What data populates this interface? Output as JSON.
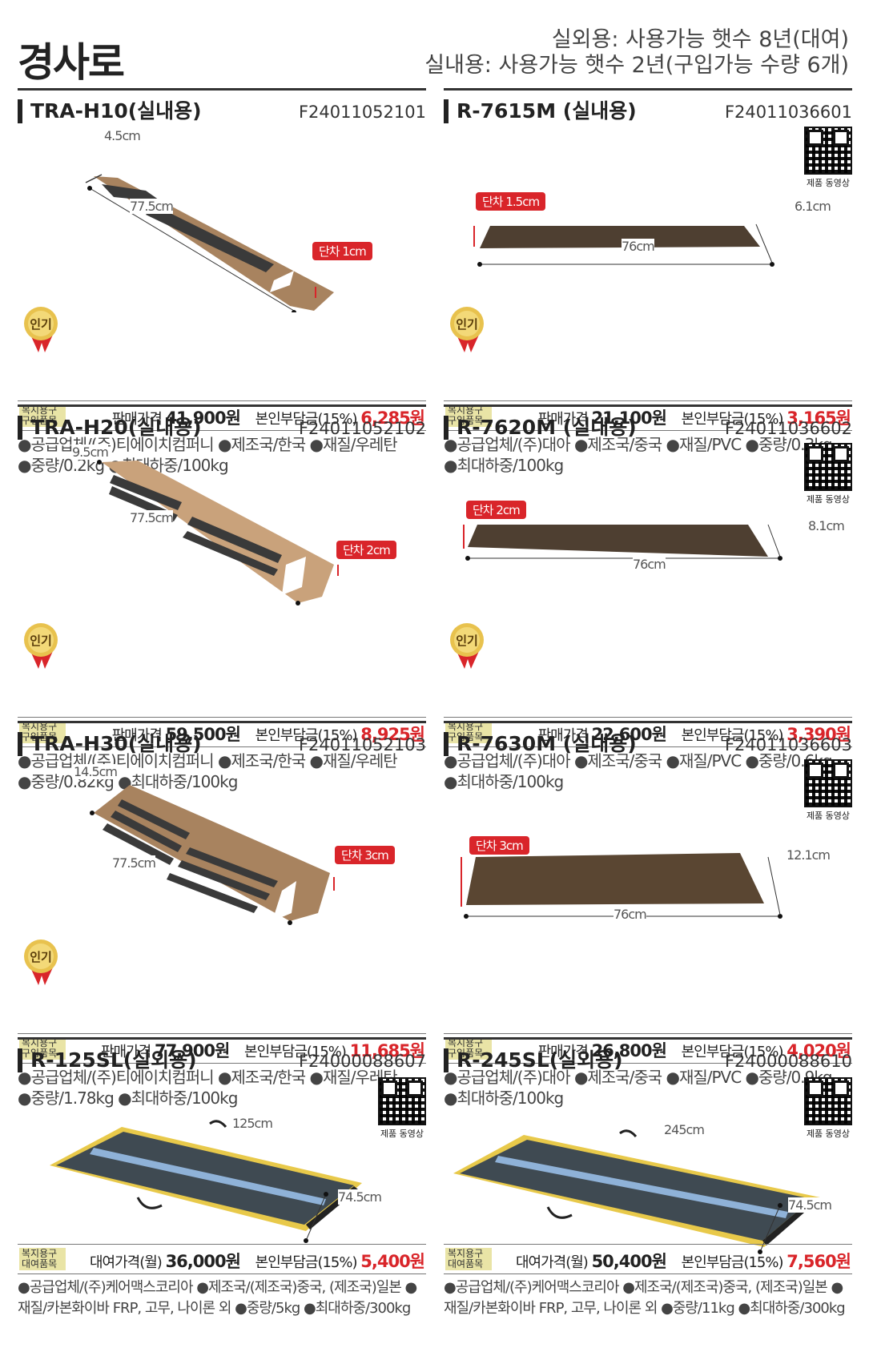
{
  "page": {
    "title": "경사로",
    "usage_lines": [
      "실외용: 사용가능 햇수 8년(대여)",
      "실내용: 사용가능 햇수 2년(구입가능 수량 6개)"
    ]
  },
  "common": {
    "popular_label": "인기",
    "qr_label": "제품 동영상",
    "sale_label": "판매가격",
    "rent_label": "대여가격(월)",
    "copay_label": "본인부담금(15%)",
    "badge_purchase": "복지용구 구입품목",
    "badge_rent": "복지용구 대여품목"
  },
  "products": [
    {
      "name": "TRA-H10(실내용)",
      "code": "F24011052101",
      "dims": [
        "4.5cm",
        "77.5cm"
      ],
      "step": "단차 1cm",
      "price": "41,900원",
      "copay": "6,285원",
      "spec": [
        "●공급업체/(주)티에이치컴퍼니 ●제조국/한국 ●재질/우레탄",
        "●중량/0.2kg ●최대하중/100kg"
      ]
    },
    {
      "name": "R-7615M (실내용)",
      "code": "F24011036601",
      "dims": [
        "6.1cm",
        "76cm"
      ],
      "step": "단차 1.5cm",
      "price": "21,100원",
      "copay": "3,165원",
      "spec": [
        "●공급업체/(주)대아 ●제조국/중국 ●재질/PVC ●중량/0.3kg",
        "●최대하중/100kg"
      ]
    },
    {
      "name": "TRA-H20(실내용)",
      "code": "F24011052102",
      "dims": [
        "9.5cm",
        "77.5cm"
      ],
      "step": "단차 2cm",
      "price": "59,500원",
      "copay": "8,925원",
      "spec": [
        "●공급업체/(주)티에이치컴퍼니 ●제조국/한국 ●재질/우레탄",
        "●중량/0.82kg ●최대하중/100kg"
      ]
    },
    {
      "name": "R-7620M (실내용)",
      "code": "F24011036602",
      "dims": [
        "8.1cm",
        "76cm"
      ],
      "step": "단차 2cm",
      "price": "22,600원",
      "copay": "3,390원",
      "spec": [
        "●공급업체/(주)대아 ●제조국/중국 ●재질/PVC ●중량/0.6kg",
        "●최대하중/100kg"
      ]
    },
    {
      "name": "TRA-H30(실내용)",
      "code": "F24011052103",
      "dims": [
        "14.5cm",
        "77.5cm"
      ],
      "step": "단차 3cm",
      "price": "77,900원",
      "copay": "11,685원",
      "spec": [
        "●공급업체/(주)티에이치컴퍼니 ●제조국/한국 ●재질/우레탄",
        "●중량/1.78kg ●최대하중/100kg"
      ]
    },
    {
      "name": "R-7630M (실내용)",
      "code": "F24011036603",
      "dims": [
        "12.1cm",
        "76cm"
      ],
      "step": "단차 3cm",
      "price": "26,800원",
      "copay": "4,020원",
      "spec": [
        "●공급업체/(주)대아 ●제조국/중국 ●재질/PVC ●중량/0.9kg",
        "●최대하중/100kg"
      ]
    },
    {
      "name": "R-125SL(실외용)",
      "code": "F24000088607",
      "dims": [
        "125cm",
        "74.5cm"
      ],
      "price": "36,000원",
      "copay": "5,400원",
      "spec": [
        "●공급업체/(주)케어맥스코리아 ●제조국/(제조국)중국, (제조국)일본 ●",
        "재질/카본화이바 FRP, 고무, 나이론 외 ●중량/5kg ●최대하중/300kg"
      ]
    },
    {
      "name": "R-245SL(실외용)",
      "code": "F24000088610",
      "dims": [
        "245cm",
        "74.5cm"
      ],
      "price": "50,400원",
      "copay": "7,560원",
      "spec": [
        "●공급업체/(주)케어맥스코리아 ●제조국/(제조국)중국, (제조국)일본 ●",
        "재질/카본화이바 FRP, 고무, 나이론 외 ●중량/11kg ●최대하중/300kg"
      ]
    }
  ],
  "colors": {
    "accent_red": "#d9252a",
    "badge_bg": "#e9e4a6",
    "brown_ramp": "#a8835f",
    "dark_ramp": "#4e3f31"
  }
}
